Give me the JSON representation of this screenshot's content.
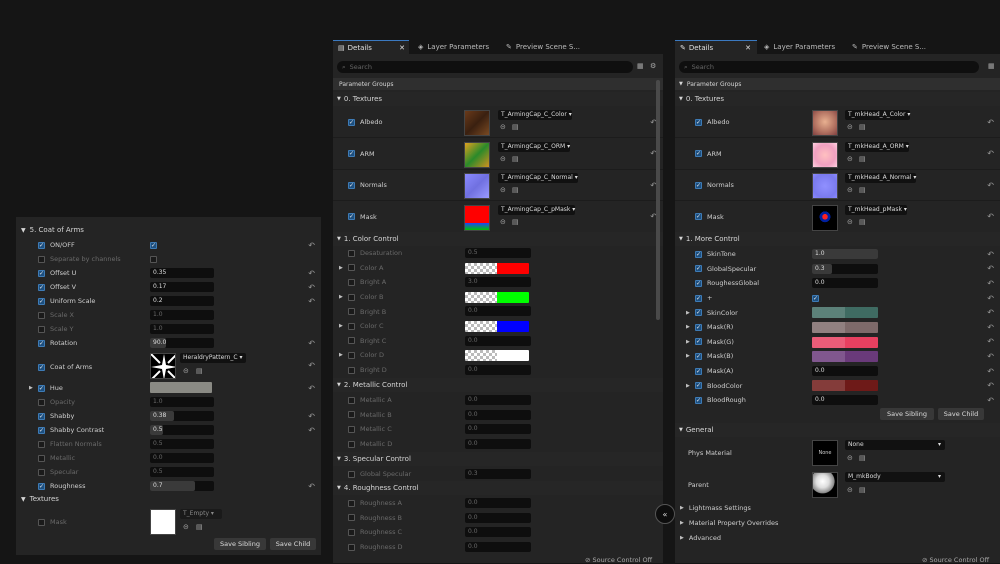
{
  "colors": {
    "accent": "#3b79c0",
    "checkbox_on": "#1d4f7f"
  },
  "left": {
    "section_coat": "5. Coat of Arms",
    "rows": [
      {
        "label": "ON/OFF",
        "check": true,
        "type": "check",
        "on": true
      },
      {
        "label": "Separate by channels",
        "check": false,
        "type": "check",
        "on": false,
        "disabled": true
      },
      {
        "label": "Offset U",
        "check": true,
        "type": "num",
        "value": "0.35",
        "fill": 0.0
      },
      {
        "label": "Offset V",
        "check": true,
        "type": "num",
        "value": "0.17",
        "fill": 0.0
      },
      {
        "label": "Uniform Scale",
        "check": true,
        "type": "num",
        "value": "0.2",
        "fill": 0.0
      },
      {
        "label": "Scale X",
        "check": false,
        "type": "num",
        "value": "1.0",
        "disabled": true
      },
      {
        "label": "Scale Y",
        "check": false,
        "type": "num",
        "value": "1.0",
        "disabled": true
      },
      {
        "label": "Rotation",
        "check": true,
        "type": "num",
        "value": "90.0",
        "fill": 0.25
      }
    ],
    "coat_label": "Coat of Arms",
    "coat_texture": "HeraldryPattern_C",
    "rows2": [
      {
        "label": "Opacity",
        "check": false,
        "value": "1.0",
        "disabled": true
      },
      {
        "label": "Shabby",
        "check": true,
        "value": "0.38",
        "fill": 0.38
      },
      {
        "label": "Shabby Contrast",
        "check": true,
        "value": "0.5",
        "fill": 0.2
      },
      {
        "label": "Flatten Normals",
        "check": false,
        "value": "0.5",
        "disabled": true
      },
      {
        "label": "Metallic",
        "check": false,
        "value": "0.0",
        "disabled": true
      },
      {
        "label": "Specular",
        "check": false,
        "value": "0.5",
        "disabled": true
      },
      {
        "label": "Roughness",
        "check": true,
        "value": "0.7",
        "fill": 0.7
      }
    ],
    "hue_label": "Hue",
    "textures_section": "Textures",
    "mask_label": "Mask",
    "mask_texture": "T_Empty",
    "save_sibling": "Save Sibling",
    "save_child": "Save Child"
  },
  "mid": {
    "tabs": [
      "Details",
      "Layer Parameters",
      "Preview Scene S..."
    ],
    "search_placeholder": "Search",
    "param_groups": "Parameter Groups",
    "textures_section": "0. Textures",
    "textures": [
      {
        "label": "Albedo",
        "tex": "T_ArmingCap_C_Color"
      },
      {
        "label": "ARM",
        "tex": "T_ArmingCap_C_ORM"
      },
      {
        "label": "Normals",
        "tex": "T_ArmingCap_C_Normal"
      },
      {
        "label": "Mask",
        "tex": "T_ArmingCap_C_pMask"
      }
    ],
    "color_section": "1. Color Control",
    "color_rows": [
      {
        "label": "Desaturation",
        "value": "0.5",
        "kind": "num"
      },
      {
        "label": "Color A",
        "kind": "color",
        "color": "#ff0000"
      },
      {
        "label": "Bright A",
        "value": "3.0",
        "kind": "num"
      },
      {
        "label": "Color B",
        "kind": "color",
        "color": "#00ff00"
      },
      {
        "label": "Bright B",
        "value": "0.0",
        "kind": "num"
      },
      {
        "label": "Color C",
        "kind": "color",
        "color": "#0000ff"
      },
      {
        "label": "Bright C",
        "value": "0.0",
        "kind": "num"
      },
      {
        "label": "Color D",
        "kind": "color",
        "color": "#ffffff"
      },
      {
        "label": "Bright D",
        "value": "0.0",
        "kind": "num"
      }
    ],
    "metallic_section": "2. Metallic Control",
    "metallic_rows": [
      {
        "label": "Metallic A",
        "value": "0.0"
      },
      {
        "label": "Metallic B",
        "value": "0.0"
      },
      {
        "label": "Metallic C",
        "value": "0.0"
      },
      {
        "label": "Metallic D",
        "value": "0.0"
      }
    ],
    "specular_section": "3. Specular Control",
    "specular_rows": [
      {
        "label": "Global Specular",
        "value": "0.3"
      }
    ],
    "roughness_section": "4. Roughness Control",
    "roughness_rows": [
      {
        "label": "Roughness A",
        "value": "0.0"
      },
      {
        "label": "Roughness B",
        "value": "0.0"
      },
      {
        "label": "Roughness C",
        "value": "0.0"
      },
      {
        "label": "Roughness D",
        "value": "0.0"
      }
    ],
    "source_control": "Source Control Off"
  },
  "right": {
    "tabs": [
      "Details",
      "Layer Parameters",
      "Preview Scene S..."
    ],
    "search_placeholder": "Search",
    "param_groups": "Parameter Groups",
    "textures_section": "0. Textures",
    "textures": [
      {
        "label": "Albedo",
        "tex": "T_mkHead_A_Color"
      },
      {
        "label": "ARM",
        "tex": "T_mkHead_A_ORM"
      },
      {
        "label": "Normals",
        "tex": "T_mkHead_A_Normal"
      },
      {
        "label": "Mask",
        "tex": "T_mkHead_pMask"
      }
    ],
    "more_section": "1. More Control",
    "more_rows": [
      {
        "label": "SkinTone",
        "kind": "num",
        "value": "1.0",
        "fill": 1.0
      },
      {
        "label": "GlobalSpecular",
        "kind": "num",
        "value": "0.3",
        "fill": 0.3
      },
      {
        "label": "RoughessGlobal",
        "kind": "num",
        "value": "0.0"
      },
      {
        "label": "+",
        "kind": "check"
      },
      {
        "label": "SkinColor",
        "kind": "color",
        "color": "#3f6b62",
        "expand": true
      },
      {
        "label": "Mask(R)",
        "kind": "color",
        "color": "#7e6a6a",
        "expand": true
      },
      {
        "label": "Mask(G)",
        "kind": "color",
        "color": "#e84060",
        "expand": true
      },
      {
        "label": "Mask(B)",
        "kind": "color",
        "color": "#6a3a7a",
        "expand": true
      },
      {
        "label": "Mask(A)",
        "kind": "num",
        "value": "0.0"
      },
      {
        "label": "BloodColor",
        "kind": "color",
        "color": "#6e1a18",
        "expand": true
      },
      {
        "label": "BloodRough",
        "kind": "num",
        "value": "0.0"
      }
    ],
    "save_sibling": "Save Sibling",
    "save_child": "Save Child",
    "general_section": "General",
    "phys_label": "Phys Material",
    "phys_value": "None",
    "phys_thumb": "None",
    "parent_label": "Parent",
    "parent_value": "M_mkBody",
    "collapsed": [
      "Lightmass Settings",
      "Material Property Overrides",
      "Advanced"
    ],
    "source_control": "Source Control Off"
  }
}
